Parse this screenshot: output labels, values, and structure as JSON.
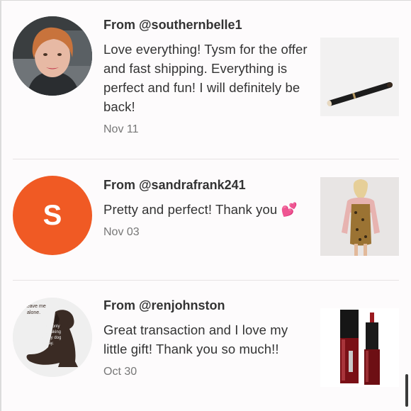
{
  "reviews": [
    {
      "from": "From @southernbelle1",
      "message": "Love everything! Tysm for the offer and fast shipping. Everything is perfect and fun! I will definitely be back!",
      "date": "Nov 11",
      "avatar": "profile-photo",
      "thumbnail": "eyeliner-pencil"
    },
    {
      "from": "From @sandrafrank241",
      "message": "Pretty and perfect! Thank you 💕",
      "date": "Nov 03",
      "avatar_letter": "S",
      "avatar_color": "#f05a24",
      "thumbnail": "pink-blazer-leopard-dress"
    },
    {
      "from": "From @renjohnston",
      "message": "Great transaction and I love my little gift! Thank you so much!!",
      "date": "Oct 30",
      "avatar": "dog-silhouette-sign",
      "avatar_text": [
        "Leave me",
        "alone.",
        "I'm only",
        "speaking",
        "to my dog",
        "today."
      ],
      "thumbnail": "liquid-lipstick"
    }
  ]
}
